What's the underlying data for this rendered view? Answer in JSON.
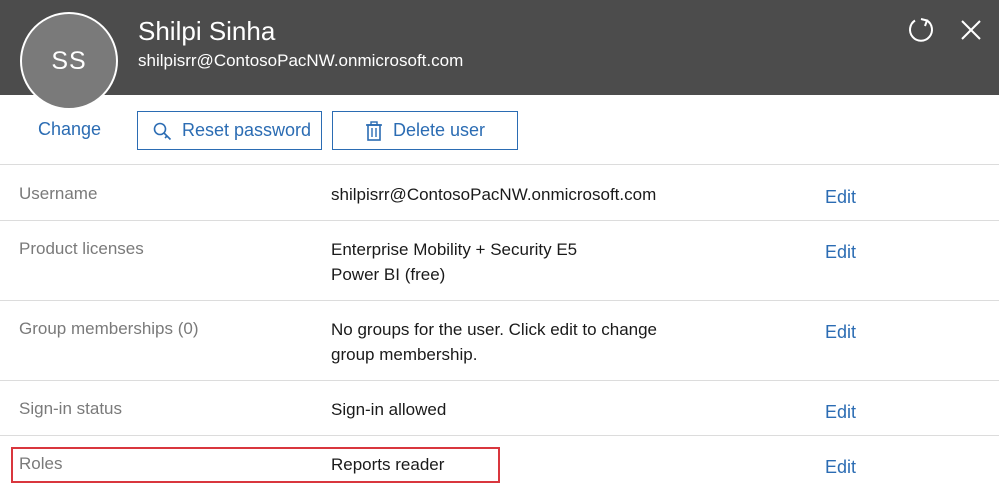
{
  "header": {
    "avatar_initials": "SS",
    "name": "Shilpi Sinha",
    "email": "shilpisrr@ContosoPacNW.onmicrosoft.com",
    "refresh_icon": "refresh-icon",
    "close_icon": "close-icon"
  },
  "actions": {
    "change_label": "Change",
    "reset_password_label": "Reset password",
    "delete_user_label": "Delete user"
  },
  "rows": [
    {
      "label": "Username",
      "value": [
        "shilpisrr@ContosoPacNW.onmicrosoft.com"
      ],
      "edit": "Edit"
    },
    {
      "label": "Product licenses",
      "value": [
        "Enterprise Mobility + Security E5",
        "Power BI (free)"
      ],
      "edit": "Edit"
    },
    {
      "label": "Group memberships (0)",
      "value": [
        "No groups for the user. Click edit to change",
        "group membership."
      ],
      "edit": "Edit"
    },
    {
      "label": "Sign-in status",
      "value": [
        "Sign-in allowed"
      ],
      "edit": "Edit"
    },
    {
      "label": "Roles",
      "value": [
        "Reports reader"
      ],
      "edit": "Edit"
    }
  ],
  "colors": {
    "header_bg": "#4c4c4c",
    "accent": "#2b6cb3",
    "highlight": "#d9363e"
  }
}
